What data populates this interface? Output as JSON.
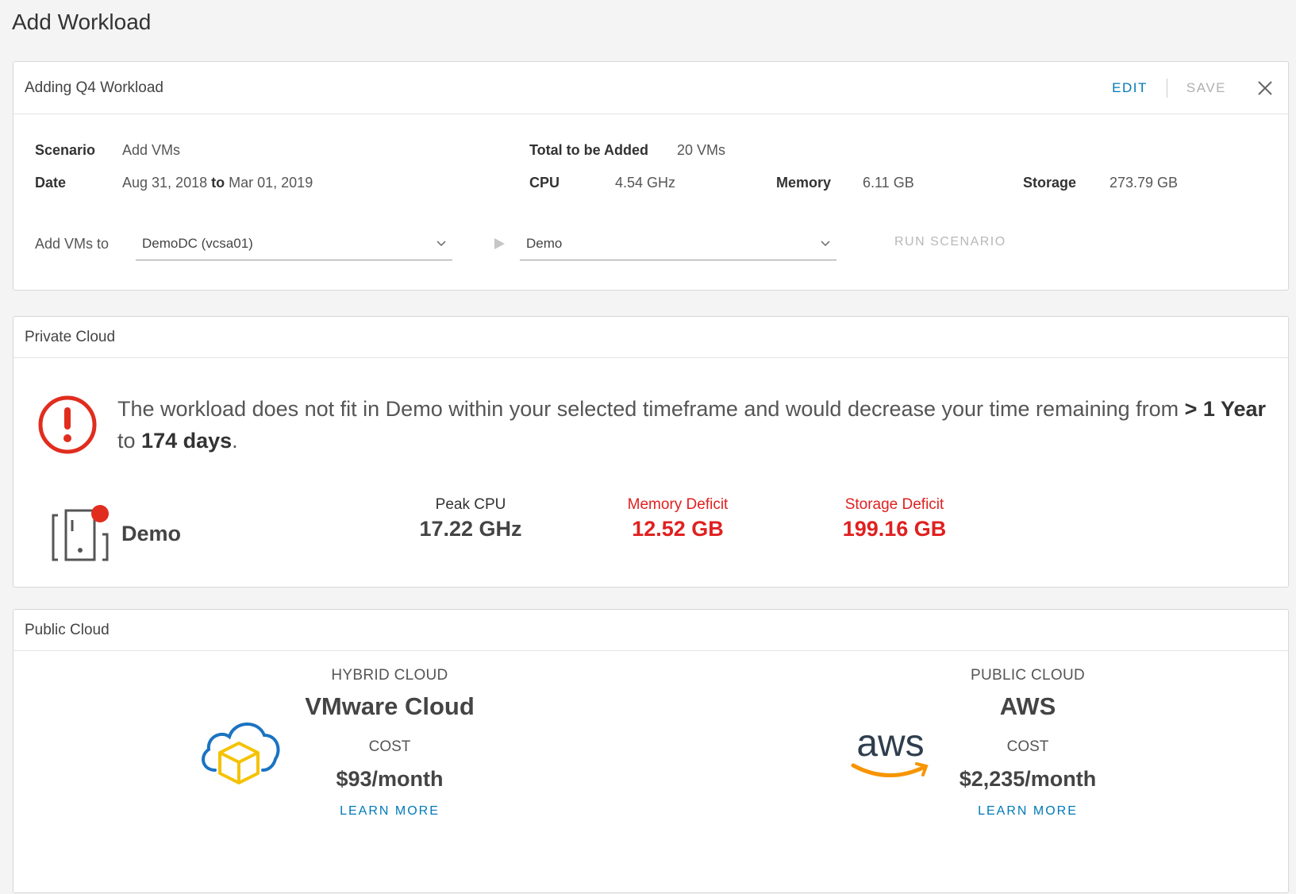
{
  "page": {
    "title": "Add Workload"
  },
  "workload": {
    "title": "Adding Q4 Workload",
    "edit_label": "EDIT",
    "save_label": "SAVE",
    "scenario_label": "Scenario",
    "scenario_value": "Add VMs",
    "date_label": "Date",
    "date_from": "Aug 31, 2018",
    "date_to_word": "to",
    "date_to": "Mar 01, 2019",
    "total_label": "Total to be Added",
    "total_value": "20 VMs",
    "cpu_label": "CPU",
    "cpu_value": "4.54 GHz",
    "memory_label": "Memory",
    "memory_value": "6.11 GB",
    "storage_label": "Storage",
    "storage_value": "273.79 GB",
    "add_vms_label": "Add VMs to",
    "datacenter_select": "DemoDC (vcsa01)",
    "cluster_select": "Demo",
    "run_label": "RUN SCENARIO"
  },
  "private_cloud": {
    "title": "Private Cloud",
    "alert_prefix": "The workload does not fit in Demo within your selected timeframe and would decrease your time remaining from",
    "alert_from": "> 1 Year",
    "alert_mid": "to",
    "alert_to": "174 days",
    "alert_end": ".",
    "host_name": "Demo",
    "peak_cpu_label": "Peak CPU",
    "peak_cpu_value": "17.22 GHz",
    "memory_deficit_label": "Memory Deficit",
    "memory_deficit_value": "12.52 GB",
    "storage_deficit_label": "Storage Deficit",
    "storage_deficit_value": "199.16 GB",
    "colors": {
      "deficit": "#e02020",
      "alert": "#e12d1e"
    }
  },
  "public_cloud": {
    "title": "Public Cloud",
    "options": [
      {
        "type": "HYBRID CLOUD",
        "name": "VMware Cloud",
        "cost_label": "COST",
        "cost": "$93/month",
        "link": "LEARN MORE",
        "icon": "vmware-cloud-icon"
      },
      {
        "type": "PUBLIC CLOUD",
        "name": "AWS",
        "cost_label": "COST",
        "cost": "$2,235/month",
        "link": "LEARN MORE",
        "icon": "aws-logo",
        "logo_text": "aws"
      }
    ],
    "colors": {
      "link": "#0079b8",
      "aws_orange": "#f79400",
      "vmc_blue": "#1b73c2",
      "vmc_yellow": "#f5c200"
    }
  }
}
